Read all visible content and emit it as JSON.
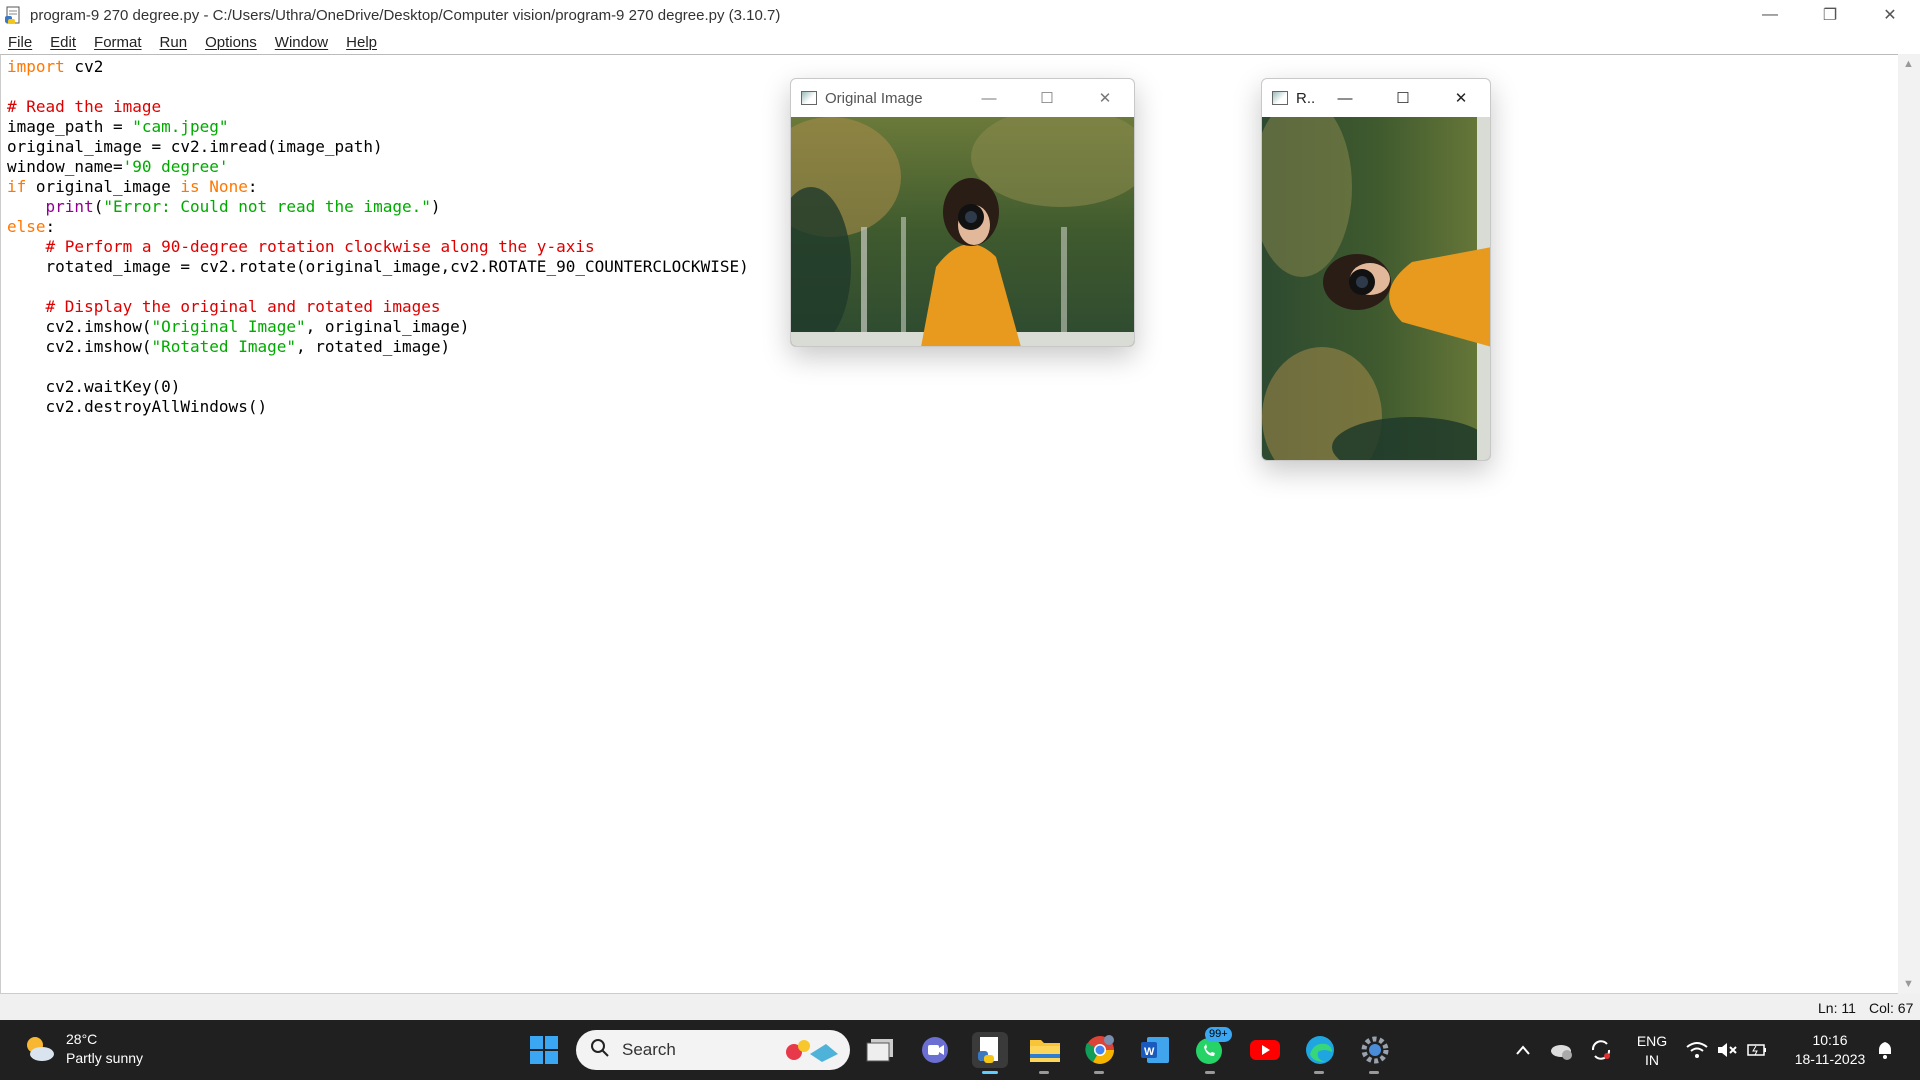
{
  "window": {
    "title": "program-9 270 degree.py - C:/Users/Uthra/OneDrive/Desktop/Computer vision/program-9 270 degree.py (3.10.7)",
    "controls": {
      "minimize": "—",
      "restore": "❐",
      "close": "✕"
    }
  },
  "menu": [
    "File",
    "Edit",
    "Format",
    "Run",
    "Options",
    "Window",
    "Help"
  ],
  "editor": {
    "lines": [
      [
        {
          "t": "import",
          "c": "kw"
        },
        {
          "t": " cv2",
          "c": ""
        }
      ],
      [],
      [
        {
          "t": "# Read the image",
          "c": "cm"
        }
      ],
      [
        {
          "t": "image_path = ",
          "c": ""
        },
        {
          "t": "\"cam.jpeg\"",
          "c": "st"
        }
      ],
      [
        {
          "t": "original_image = cv2.imread(image_path)",
          "c": ""
        }
      ],
      [
        {
          "t": "window_name=",
          "c": ""
        },
        {
          "t": "'90 degree'",
          "c": "st"
        }
      ],
      [
        {
          "t": "if",
          "c": "kw"
        },
        {
          "t": " original_image ",
          "c": ""
        },
        {
          "t": "is",
          "c": "kw"
        },
        {
          "t": " ",
          "c": ""
        },
        {
          "t": "None",
          "c": "kw"
        },
        {
          "t": ":",
          "c": ""
        }
      ],
      [
        {
          "t": "    ",
          "c": ""
        },
        {
          "t": "print",
          "c": "bi"
        },
        {
          "t": "(",
          "c": ""
        },
        {
          "t": "\"Error: Could not read the image.\"",
          "c": "st"
        },
        {
          "t": ")",
          "c": ""
        }
      ],
      [
        {
          "t": "else",
          "c": "kw"
        },
        {
          "t": ":",
          "c": ""
        }
      ],
      [
        {
          "t": "    ",
          "c": ""
        },
        {
          "t": "# Perform a 90-degree rotation clockwise along the y-axis",
          "c": "cm"
        }
      ],
      [
        {
          "t": "    rotated_image = cv2.rotate(original_image,cv2.ROTATE_90_COUNTERCLOCKWISE)",
          "c": ""
        }
      ],
      [],
      [
        {
          "t": "    ",
          "c": ""
        },
        {
          "t": "# Display the original and rotated images",
          "c": "cm"
        }
      ],
      [
        {
          "t": "    cv2.imshow(",
          "c": ""
        },
        {
          "t": "\"Original Image\"",
          "c": "st"
        },
        {
          "t": ", original_image)",
          "c": ""
        }
      ],
      [
        {
          "t": "    cv2.imshow(",
          "c": ""
        },
        {
          "t": "\"Rotated Image\"",
          "c": "st"
        },
        {
          "t": ", rotated_image)",
          "c": ""
        }
      ],
      [],
      [
        {
          "t": "    cv2.waitKey(0)",
          "c": ""
        }
      ],
      [
        {
          "t": "    cv2.destroyAllWindows()",
          "c": ""
        }
      ]
    ]
  },
  "status": {
    "line": "Ln: 11",
    "col": "Col: 67"
  },
  "cv_windows": {
    "original": {
      "title": "Original Image"
    },
    "rotated": {
      "title": "R.."
    }
  },
  "taskbar": {
    "weather": {
      "temp": "28°C",
      "desc": "Partly sunny"
    },
    "search_label": "Search",
    "whatsapp_badge": "99+",
    "tray": {
      "lang1": "ENG",
      "lang2": "IN",
      "time": "10:16",
      "date": "18-11-2023"
    }
  },
  "colors": {
    "keyword": "#ff7700",
    "comment": "#dd0000",
    "string": "#00aa00",
    "builtin": "#900090",
    "taskbar": "#202020"
  }
}
